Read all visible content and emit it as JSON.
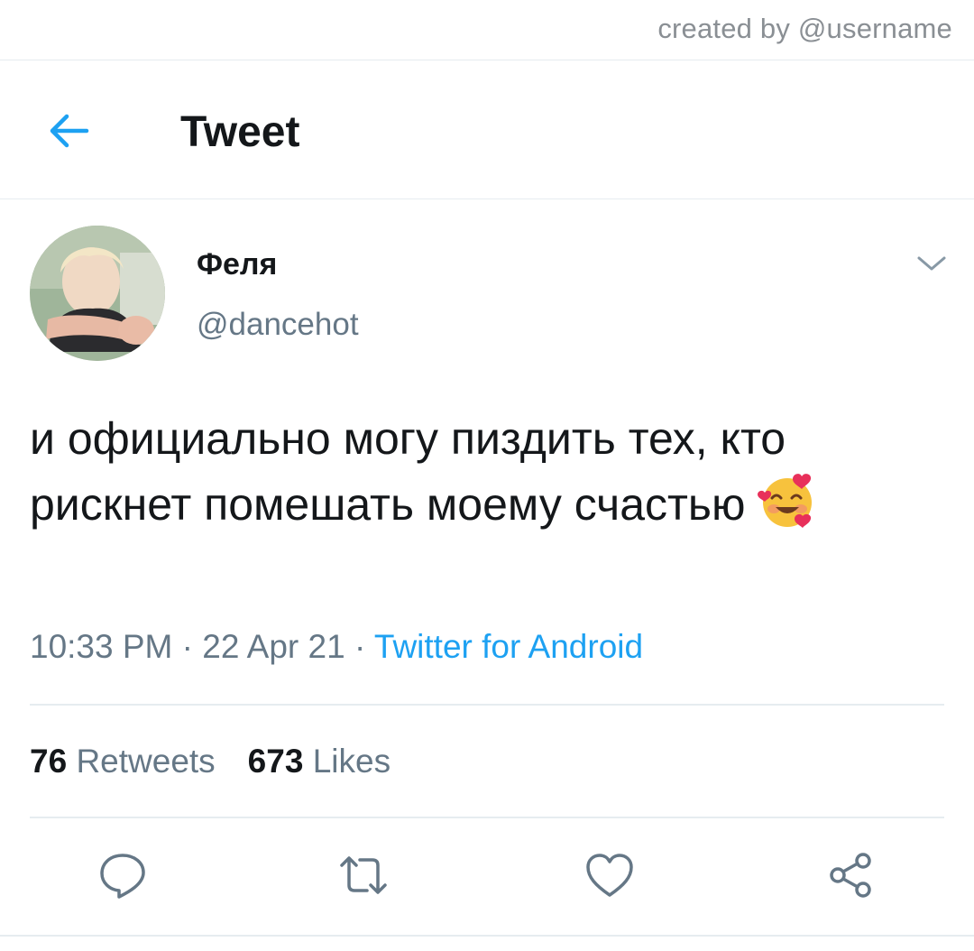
{
  "watermark": "created by @username",
  "header": {
    "back_icon": "arrow-left-icon",
    "title": "Tweet"
  },
  "tweet": {
    "author": {
      "display_name": "Феля",
      "handle": "@dancehot",
      "avatar_icon": "profile-photo"
    },
    "text": "и официально могу пиздить тех, кто рискнет помешать моему счастью",
    "emoji_icon": "smiling-face-with-hearts-emoji",
    "time": "10:33 PM",
    "separator": " · ",
    "date": "22 Apr 21",
    "source": "Twitter for Android",
    "stats": {
      "retweets_count": "76",
      "retweets_label": "Retweets",
      "likes_count": "673",
      "likes_label": "Likes"
    },
    "actions": [
      "reply-icon",
      "retweet-icon",
      "like-icon",
      "share-icon"
    ]
  },
  "colors": {
    "accent": "#1da1f2",
    "text_primary": "#14171a",
    "text_secondary": "#657786",
    "divider": "#e6ecf0"
  }
}
